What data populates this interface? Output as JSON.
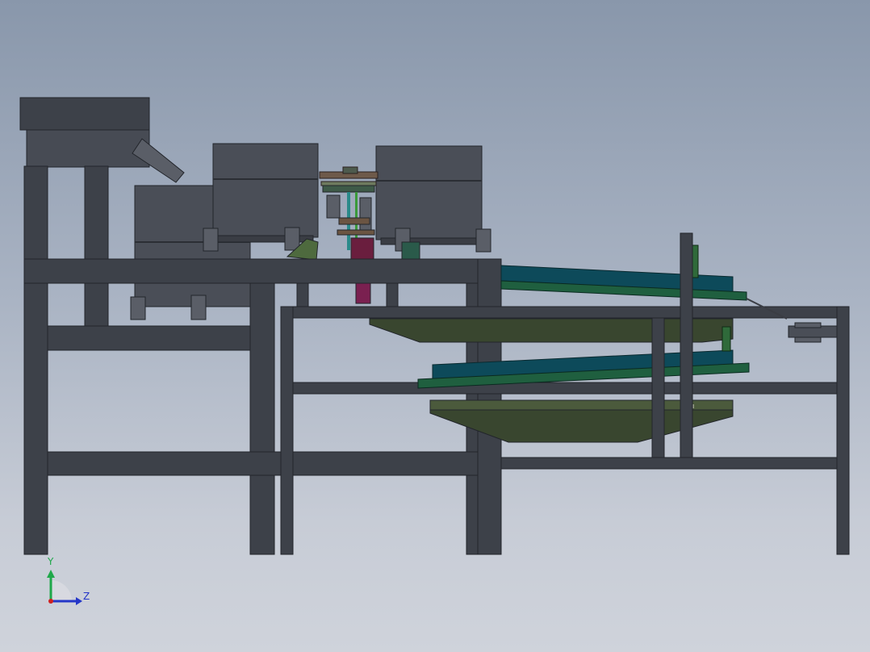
{
  "view": {
    "background_top": "#8997ab",
    "background_bottom": "#cfd3db",
    "frame_color": "#3d4149",
    "bowl_color": "#4a4e57",
    "conveyor_blue": "#0d4a5a",
    "conveyor_green": "#1f5f3f",
    "tray_color": "#39462f",
    "mechanism_magenta": "#6a1e3e"
  },
  "triad": {
    "axes": [
      {
        "label": "Y",
        "icon": "y-axis-arrow-icon",
        "color": "#1fa84a"
      },
      {
        "label": "Z",
        "icon": "z-axis-arrow-icon",
        "color": "#2436c8"
      },
      {
        "label": "",
        "icon": "x-axis-origin-icon",
        "color": "#d02020"
      }
    ]
  }
}
